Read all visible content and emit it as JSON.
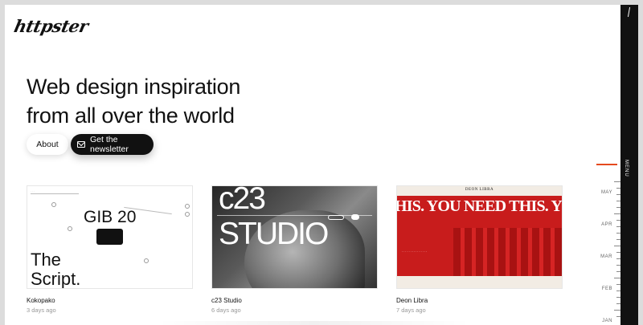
{
  "brand": {
    "logo_text": "httpster"
  },
  "hero": {
    "line1": "Web design inspiration",
    "line2": "from all over the world"
  },
  "actions": {
    "about_label": "About",
    "newsletter_label": "Get the newsletter"
  },
  "cards": [
    {
      "title": "Kokopako",
      "date": "3 days ago",
      "thumb_text_1": "GIB 20",
      "thumb_text_2": "The",
      "thumb_text_3": "Script."
    },
    {
      "title": "c23 Studio",
      "date": "6 days ago",
      "thumb_text_1": "c23 STUDIO"
    },
    {
      "title": "Deon Libra",
      "date": "7 days ago",
      "thumb_brand": "DEON LIBRA",
      "thumb_text_1": "HIS. YOU NEED THIS. YOU NEED"
    }
  ],
  "menu": {
    "label": "MENU"
  },
  "timeline": {
    "months": [
      "MAY",
      "APR",
      "MAR",
      "FEB",
      "JAN"
    ],
    "accent_color": "#e54a1e"
  },
  "colors": {
    "menu_bg": "#111111",
    "deon_red": "#c81c1c"
  }
}
